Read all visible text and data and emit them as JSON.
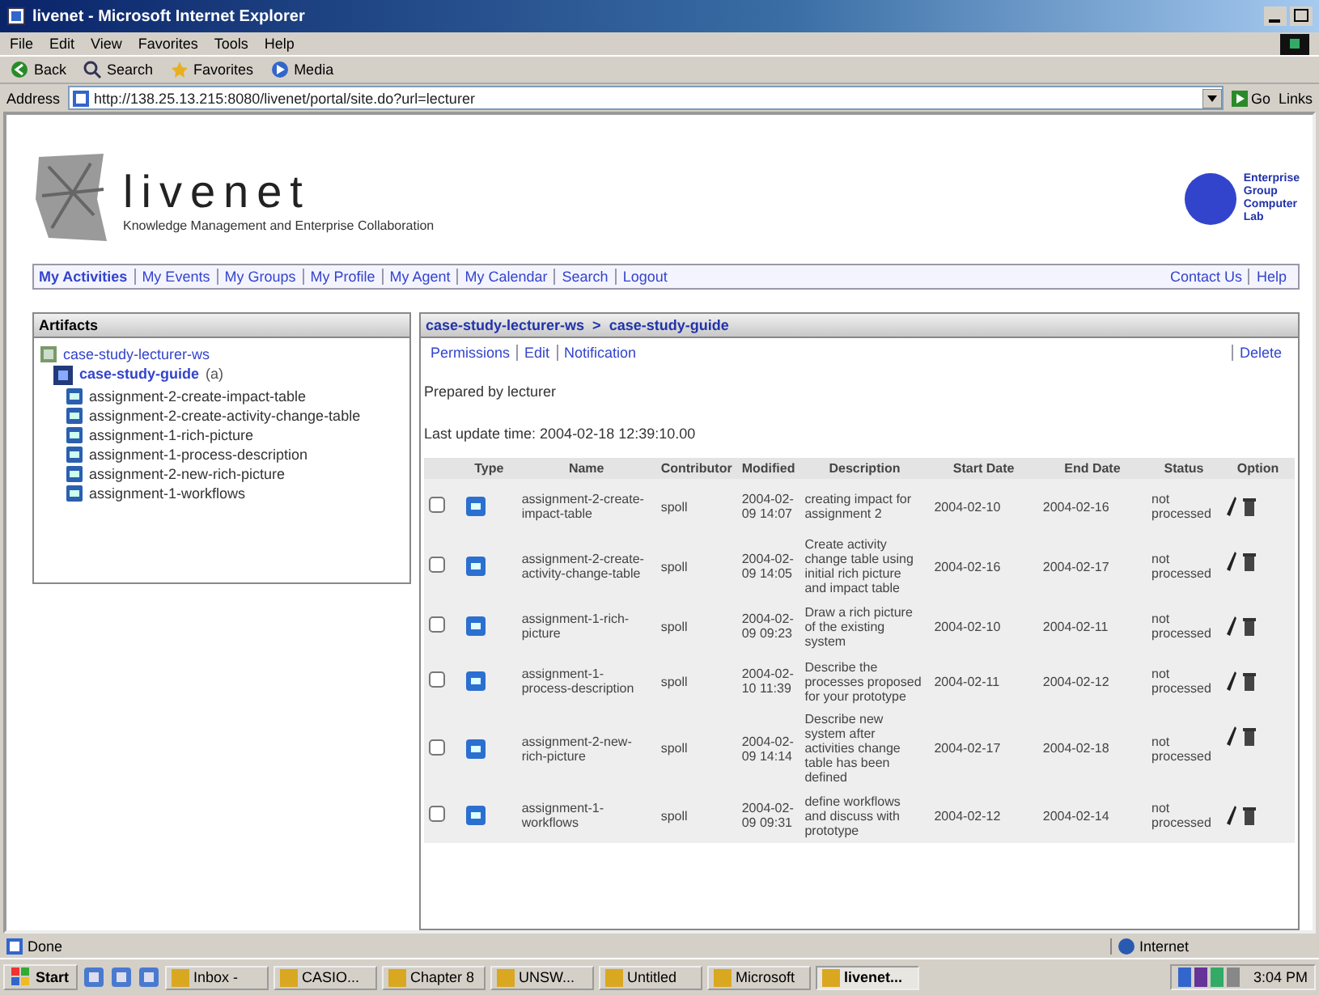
{
  "browser": {
    "title": "livenet - Microsoft Internet Explorer",
    "menu": [
      "File",
      "Edit",
      "View",
      "Favorites",
      "Tools",
      "Help"
    ],
    "toolbar": [
      "Back",
      "Search",
      "Favorites",
      "Media"
    ],
    "address_label": "Address",
    "address": "http://138.25.13.215:8080/livenet/portal/site.do?url=lecturer",
    "go": "Go",
    "links": "Links"
  },
  "header": {
    "brand": "livenet",
    "tagline": "Knowledge Management and Enterprise Collaboration",
    "partner_lines": [
      "Enterprise",
      "Group",
      "Computer",
      "Lab"
    ]
  },
  "nav": {
    "left": [
      {
        "label": "My Activities",
        "selected": true
      },
      {
        "label": "My Events",
        "selected": false
      },
      {
        "label": "My Groups",
        "selected": false
      },
      {
        "label": "My Profile",
        "selected": false
      },
      {
        "label": "My Agent",
        "selected": false
      },
      {
        "label": "My Calendar",
        "selected": false
      },
      {
        "label": "Search",
        "selected": false
      },
      {
        "label": "Logout",
        "selected": false
      }
    ],
    "right": [
      "Contact Us",
      "Help"
    ]
  },
  "sidebar": {
    "title": "Artifacts",
    "tree": [
      {
        "label": "case-study-lecturer-ws",
        "children": [
          {
            "label": "case-study-guide",
            "badge": "(a)",
            "children": [
              {
                "label": "assignment-2-create-impact-table"
              },
              {
                "label": "assignment-2-create-activity-change-table"
              },
              {
                "label": "assignment-1-rich-picture"
              },
              {
                "label": "assignment-1-process-description"
              },
              {
                "label": "assignment-2-new-rich-picture"
              },
              {
                "label": "assignment-1-workflows"
              }
            ]
          }
        ]
      }
    ]
  },
  "content": {
    "breadcrumb": [
      "case-study-lecturer-ws",
      ">",
      "case-study-guide"
    ],
    "actions": [
      "Permissions",
      "Edit",
      "Notification"
    ],
    "delete": "Delete",
    "prepared": "Prepared by lecturer",
    "updated": "Last update time: 2004-02-18 12:39:10.00",
    "table": {
      "columns": [
        "Type",
        "Name",
        "Contributor",
        "Modified",
        "Description",
        "Start Date",
        "End Date",
        "Status",
        "Option"
      ],
      "rows": [
        {
          "checked": false,
          "name": "assignment-2-create-impact-table",
          "contributor": "spoll",
          "modified": "2004-02-09 14:07",
          "description": "creating impact for assignment 2",
          "start": "2004-02-10",
          "end": "2004-02-16",
          "status": "not processed"
        },
        {
          "checked": false,
          "name": "assignment-2-create-activity-change-table",
          "contributor": "spoll",
          "modified": "2004-02-09 14:05",
          "description": "Create activity change table using initial rich picture and impact table",
          "start": "2004-02-16",
          "end": "2004-02-17",
          "status": "not processed"
        },
        {
          "checked": false,
          "name": "assignment-1-rich-picture",
          "contributor": "spoll",
          "modified": "2004-02-09 09:23",
          "description": "Draw a rich picture of the existing system",
          "start": "2004-02-10",
          "end": "2004-02-11",
          "status": "not processed"
        },
        {
          "checked": false,
          "name": "assignment-1-process-description",
          "contributor": "spoll",
          "modified": "2004-02-10 11:39",
          "description": "Describe the processes proposed for your prototype",
          "start": "2004-02-11",
          "end": "2004-02-12",
          "status": "not processed"
        },
        {
          "checked": false,
          "name": "assignment-2-new-rich-picture",
          "contributor": "spoll",
          "modified": "2004-02-09 14:14",
          "description": "Describe new system after activities change table has been defined",
          "start": "2004-02-17",
          "end": "2004-02-18",
          "status": "not processed"
        },
        {
          "checked": false,
          "name": "assignment-1-workflows",
          "contributor": "spoll",
          "modified": "2004-02-09 09:31",
          "description": "define workflows and discuss with prototype",
          "start": "2004-02-12",
          "end": "2004-02-14",
          "status": "not processed"
        }
      ]
    }
  },
  "status_bar": {
    "text": "Done",
    "zone": "Internet"
  },
  "taskbar": {
    "start": "Start",
    "items": [
      {
        "label": "Inbox -",
        "selected": false
      },
      {
        "label": "CASIO...",
        "selected": false
      },
      {
        "label": "Chapter 8",
        "selected": false
      },
      {
        "label": "UNSW...",
        "selected": false
      },
      {
        "label": "Untitled",
        "selected": false
      },
      {
        "label": "Microsoft",
        "selected": false
      },
      {
        "label": "livenet...",
        "selected": true
      }
    ],
    "clock": "3:04 PM"
  }
}
